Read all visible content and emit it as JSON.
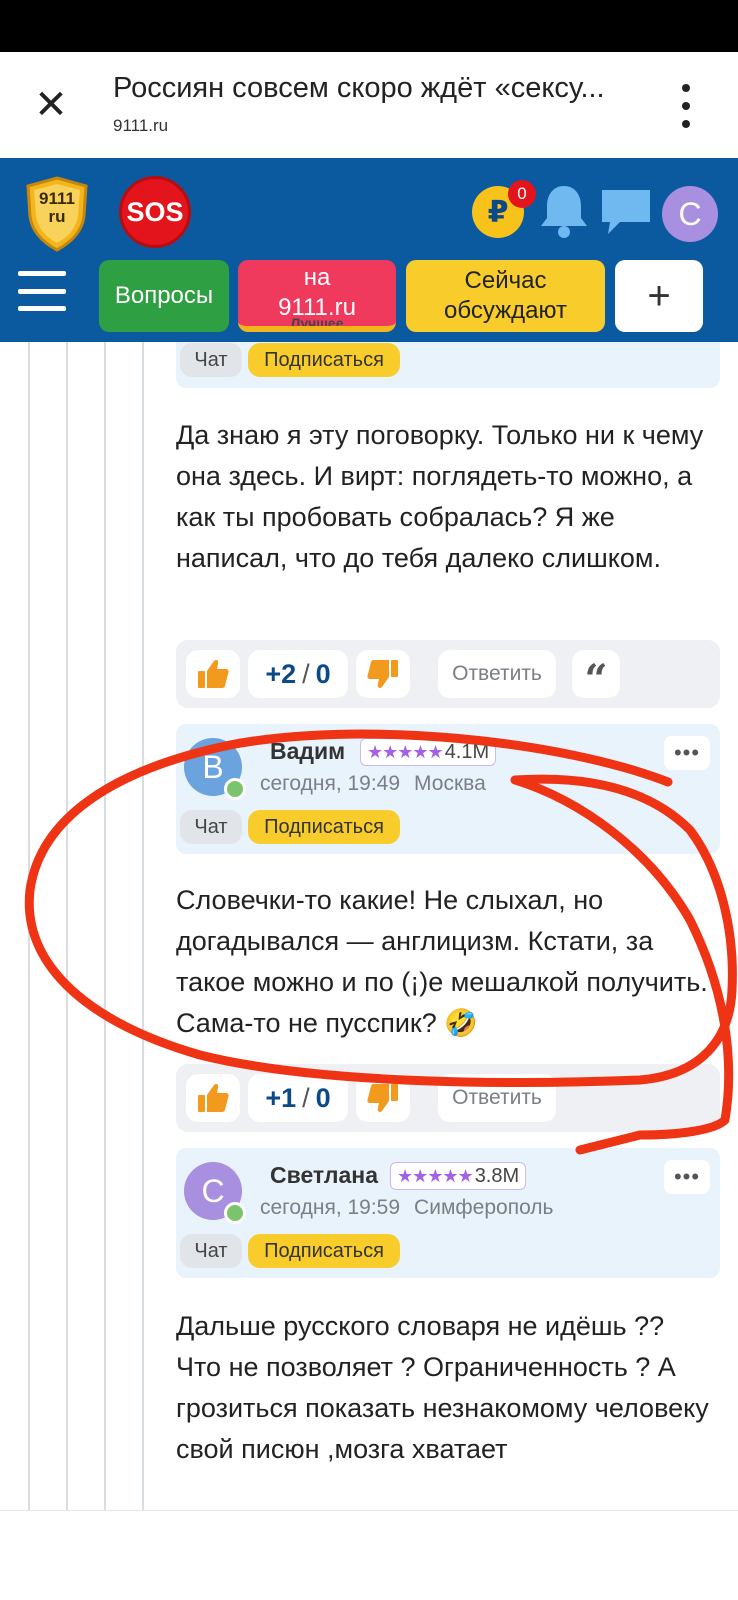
{
  "browser": {
    "title": "Россиян совсем скоро ждёт «сексу...",
    "url": "9111.ru"
  },
  "header": {
    "logo_text": "9111\nru",
    "sos_label": "SOS",
    "coin_symbol": "₽",
    "coin_badge": "0",
    "avatar_letter": "С"
  },
  "nav": {
    "questions": "Вопросы",
    "site": "на\n9111.ru",
    "site_strip": "Лучшее",
    "discuss": "Сейчас\nобсуждают",
    "plus": "+"
  },
  "card0": {
    "chat": "Чат",
    "subscribe": "Подписаться"
  },
  "comment1": {
    "text": "Да знаю я эту поговорку. Только ни к чему она здесь. И вирт: поглядеть-то можно, а как ты пробовать собралась? Я же написал, что до тебя далеко слишком.",
    "votes_up": "+2",
    "votes_sep": "/",
    "votes_down": "0",
    "reply": "Ответить",
    "quote": "“"
  },
  "card2": {
    "avatar_letter": "В",
    "avatar_color": "#6aa3dd",
    "name": "Вадим",
    "stars": "★★★★★",
    "rating": "4.1M",
    "time": "сегодня, 19:49",
    "city": "Москва",
    "more": "•••",
    "chat": "Чат",
    "subscribe": "Подписаться"
  },
  "comment2": {
    "text": "Словечки-то какие! Не слыхал, но догадывался — англицизм. Кстати, за такое можно и по (¡)е мешалкой получить. Сама-то не пусспик? 🤣",
    "votes_up": "+1",
    "votes_sep": "/",
    "votes_down": "0",
    "reply": "Ответить"
  },
  "card3": {
    "avatar_letter": "С",
    "avatar_color": "#a88fe0",
    "name": "Светлана",
    "stars": "★★★★★",
    "rating": "3.8M",
    "time": "сегодня, 19:59",
    "city": "Симферополь",
    "more": "•••",
    "chat": "Чат",
    "subscribe": "Подписаться"
  },
  "comment3": {
    "text": "Дальше русского словаря не идёшь ?? Что не позволяет ? Ограниченность ? А грозиться показать незнакомому человеку свой писюн ,мозга хватает"
  },
  "colors": {
    "header_blue": "#0b5aa0",
    "questions_green": "#2ea043",
    "site_red": "#ef3a5d",
    "discuss_yellow": "#f7cc2b",
    "vote_blue": "#0b4a87",
    "card_bg": "#e9f3fc",
    "annotation_red": "#ee3415"
  }
}
